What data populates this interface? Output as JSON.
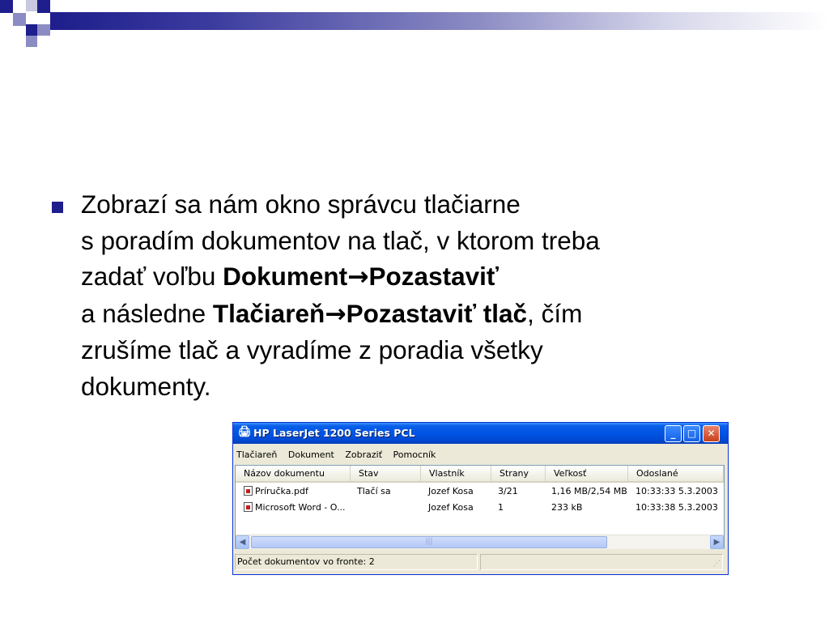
{
  "slide": {
    "line1": "Zobrazí sa nám okno správcu tlačiarne",
    "line2": "s poradím dokumentov na tlač, v ktorom treba",
    "line3_pre": "zadať voľbu ",
    "line3_b1": "Dokument",
    "arrow1": "→",
    "line3_b2": "Pozastaviť",
    "line4_pre": "a následne ",
    "line4_b1": "Tlačiareň",
    "arrow2": "→",
    "line4_b2": "Pozastaviť tlač",
    "line4_post": ", čím",
    "line5": "zrušíme tlač a vyradíme z poradia všetky",
    "line6": "dokumenty."
  },
  "window": {
    "title": "HP LaserJet 1200 Series PCL",
    "menu": [
      "Tlačiareň",
      "Dokument",
      "Zobraziť",
      "Pomocník"
    ],
    "columns": [
      "Názov dokumentu",
      "Stav",
      "Vlastník",
      "Strany",
      "Veľkosť",
      "Odoslané"
    ],
    "rows": [
      [
        "Príručka.pdf",
        "Tlačí sa",
        "Jozef Kosa",
        "3/21",
        "1,16 MB/2,54 MB",
        "10:33:33  5.3.2003"
      ],
      [
        "Microsoft Word - O...",
        "",
        "Jozef Kosa",
        "1",
        "233 kB",
        "10:33:38  5.3.2003"
      ]
    ],
    "status": "Počet dokumentov vo fronte: 2",
    "buttons": {
      "min": "_",
      "max": "□",
      "close": "✕"
    }
  },
  "colors": {
    "accent": "#1e1e8c",
    "titlebar": "#0054e3"
  }
}
